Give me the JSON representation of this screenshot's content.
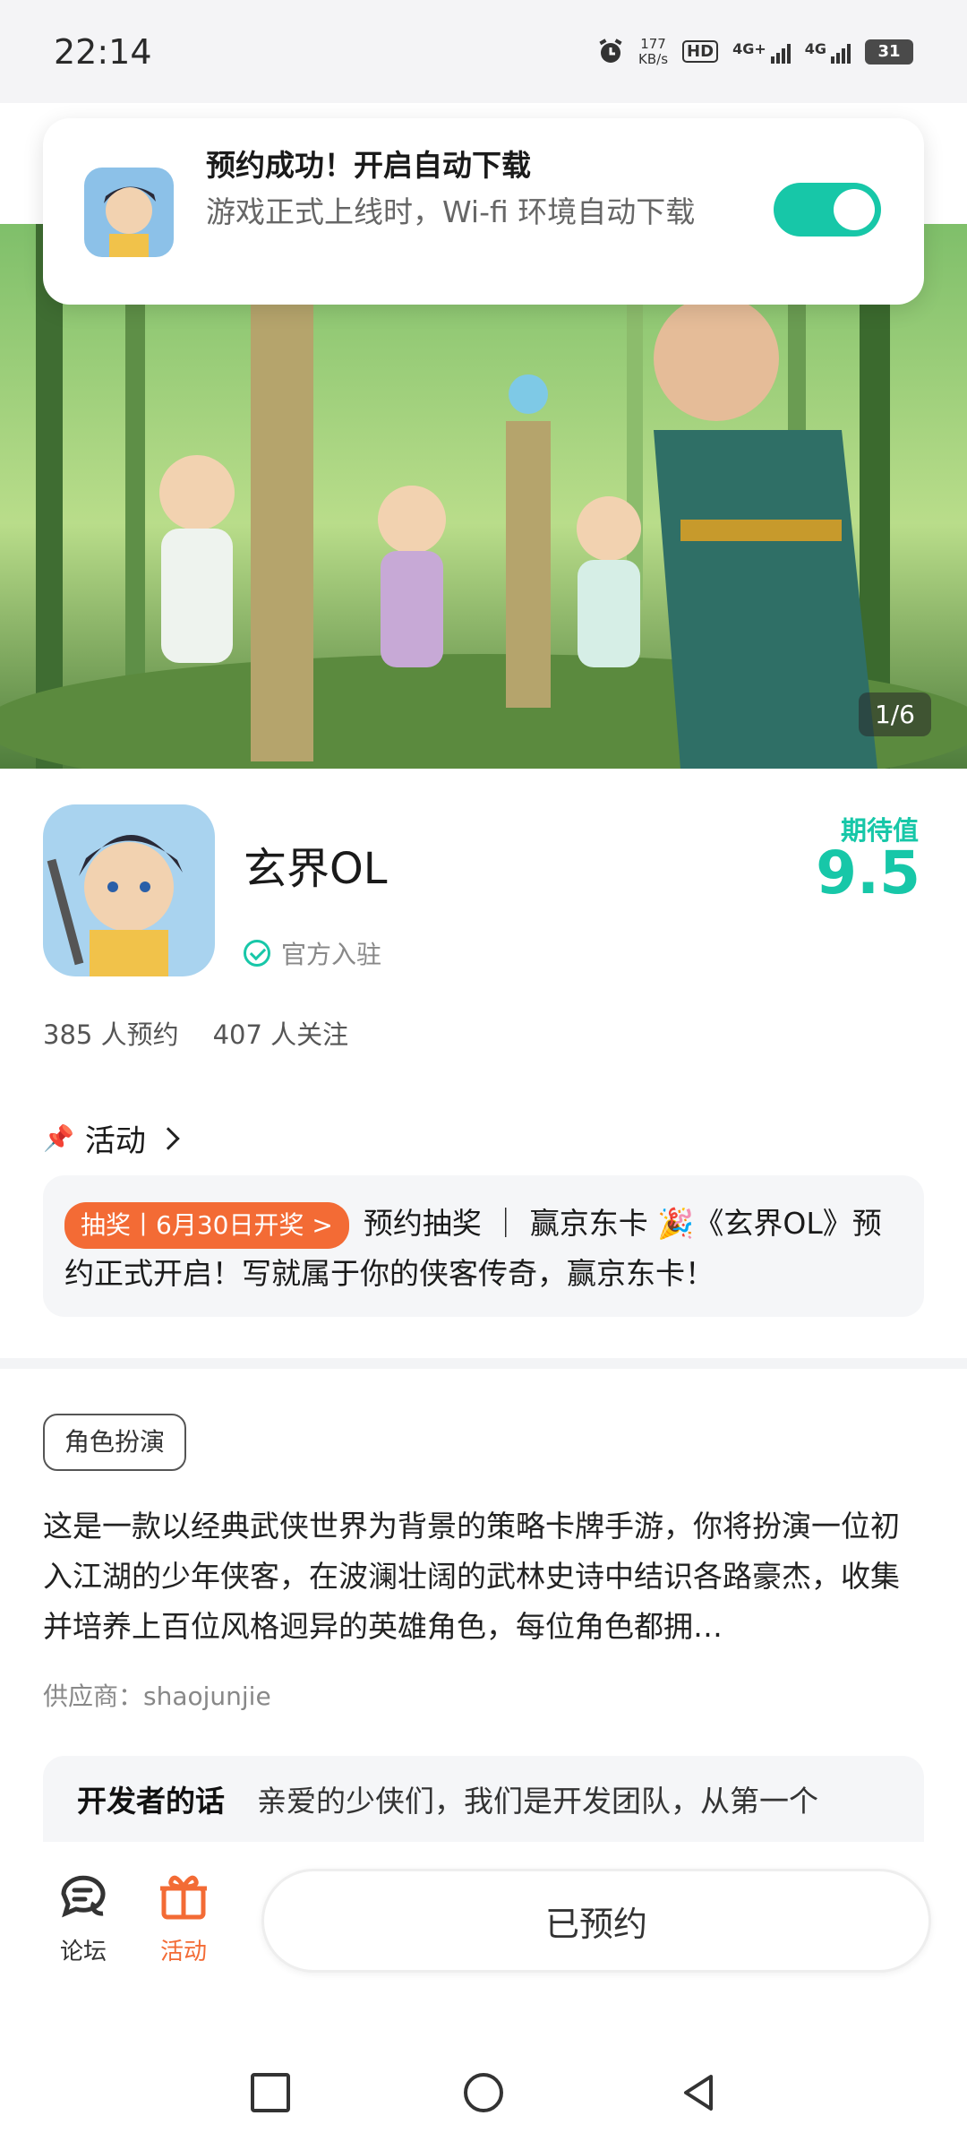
{
  "status_bar": {
    "time": "22:14",
    "speed_value": "177",
    "speed_unit": "KB/s",
    "hd": "HD",
    "net1": "4G+",
    "net2": "4G",
    "battery": "31",
    "icons": [
      "alarm-icon",
      "hd-icon",
      "signal-icon",
      "signal-icon",
      "battery-icon"
    ]
  },
  "notice": {
    "title": "预约成功！开启自动下载",
    "description": "游戏正式上线时，Wi-fi 环境自动下载",
    "toggle_on": true
  },
  "banner": {
    "page_indicator": "1/6"
  },
  "game": {
    "name": "玄界OL",
    "official_label": "官方入驻",
    "expect_label": "期待值",
    "expect_value": "9.5",
    "reservations": "385 人预约",
    "followers": "407 人关注"
  },
  "activity": {
    "header": "活动",
    "tag": "抽奖丨6月30日开奖 >",
    "text": "预约抽奖 ｜ 赢京东卡 🎉《玄界OL》预约正式开启！写就属于你的侠客传奇，赢京东卡！"
  },
  "details": {
    "genre_tag": "角色扮演",
    "description": "这是一款以经典武侠世界为背景的策略卡牌手游，你将扮演一位初入江湖的少年侠客，在波澜壮阔的武林史诗中结识各路豪杰，收集并培养上百位风格迥异的英雄角色，每位角色都拥…",
    "supplier": "供应商：shaojunjie"
  },
  "developer": {
    "label": "开发者的话",
    "text": "亲爱的少侠们，我们是开发团队，从第一个"
  },
  "bottom_bar": {
    "forum_label": "论坛",
    "activity_label": "活动",
    "reserve_button": "已预约"
  },
  "colors": {
    "accent": "#17c7a8",
    "orange": "#f36b35"
  }
}
